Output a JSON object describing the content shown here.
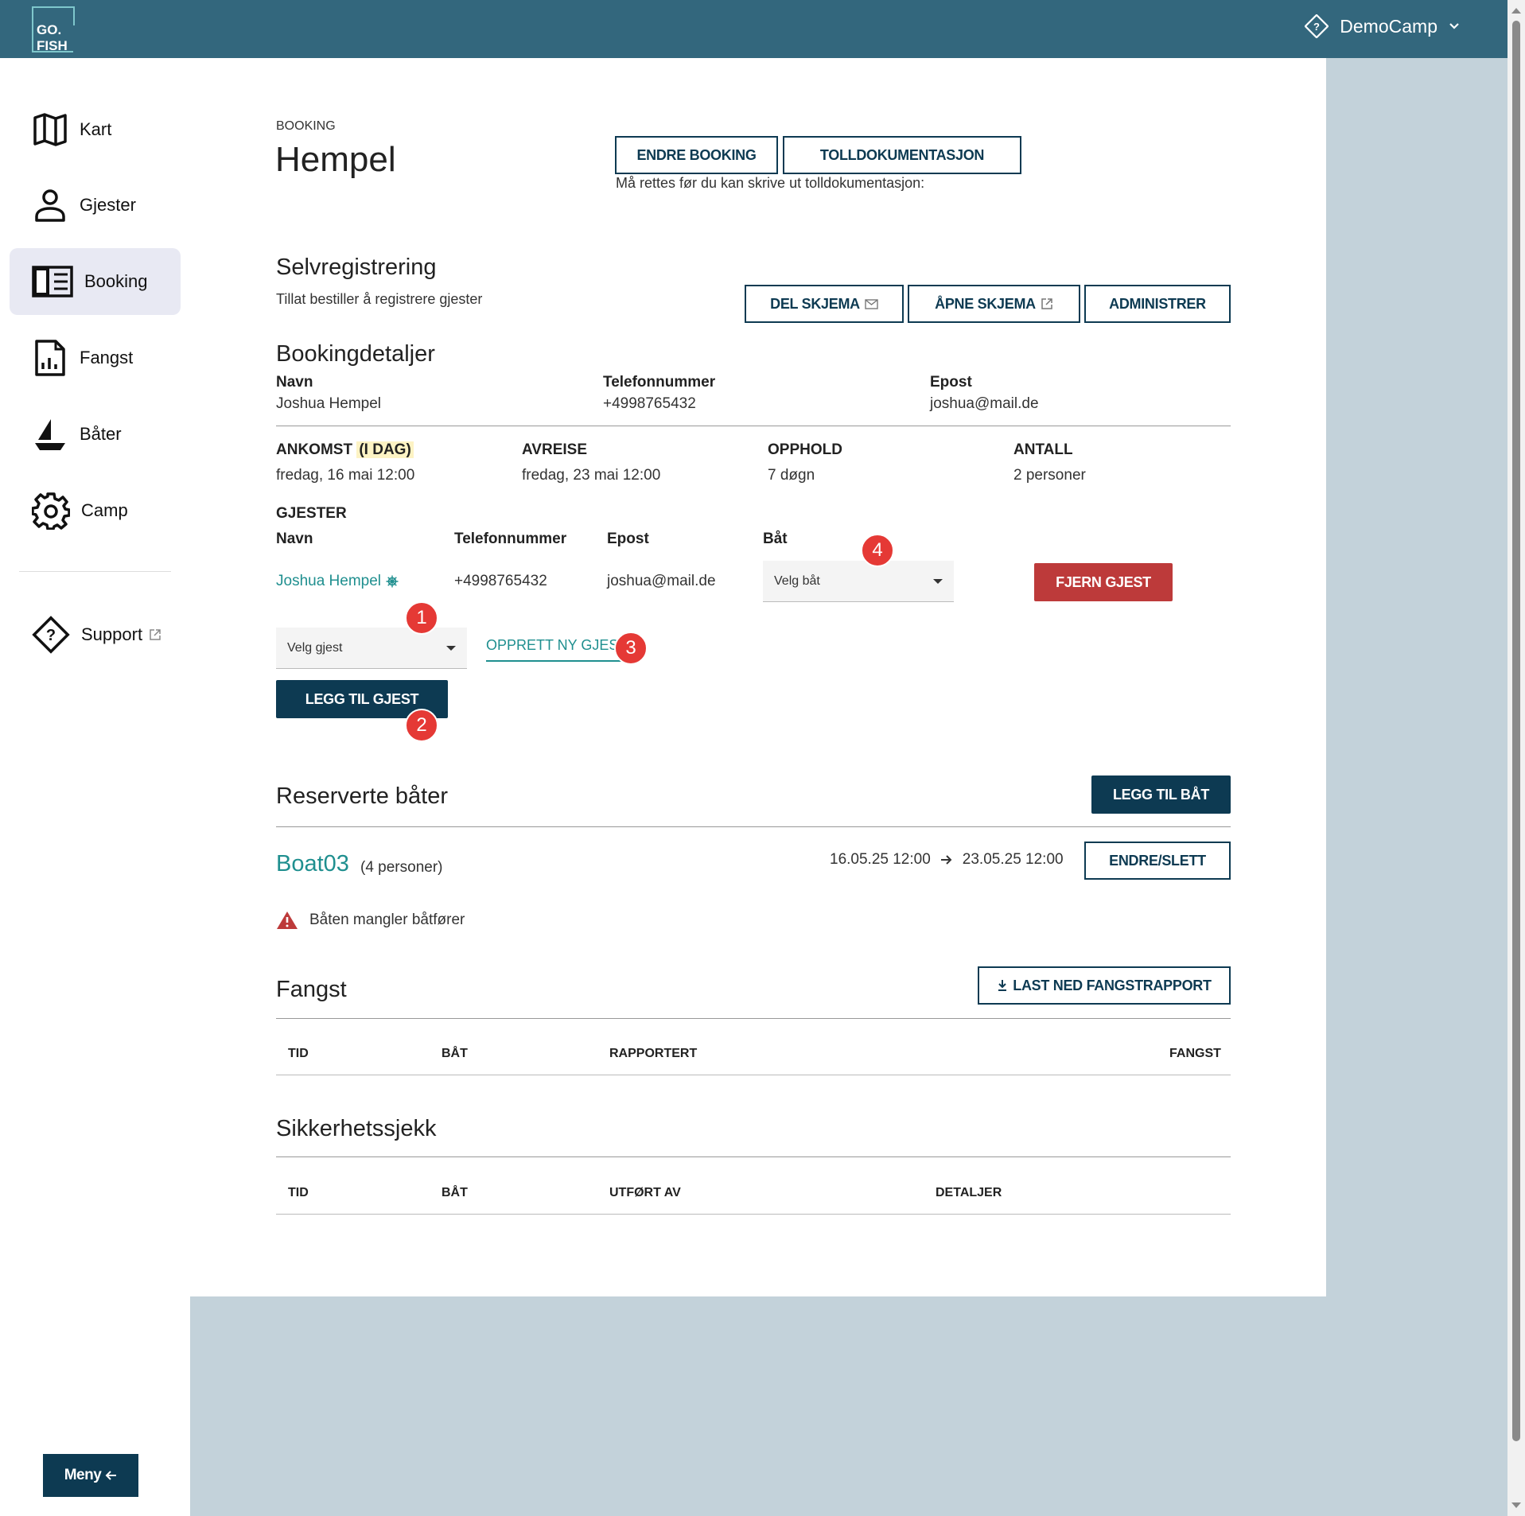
{
  "app": {
    "logo_line1": "GO.",
    "logo_line2": "FISH",
    "camp_name": "DemoCamp"
  },
  "sidebar": {
    "items": [
      {
        "label": "Kart",
        "icon": "map-icon"
      },
      {
        "label": "Gjester",
        "icon": "person-icon"
      },
      {
        "label": "Booking",
        "icon": "book-icon"
      },
      {
        "label": "Fangst",
        "icon": "report-icon"
      },
      {
        "label": "Båter",
        "icon": "sailboat-icon"
      },
      {
        "label": "Camp",
        "icon": "gear-icon"
      }
    ],
    "support_label": "Support",
    "menu_label": "Meny",
    "active": "Booking"
  },
  "header": {
    "kicker": "BOOKING",
    "title": "Hempel",
    "edit_booking": "ENDRE BOOKING",
    "customs_docs": "TOLLDOKUMENTASJON",
    "customs_note": "Må rettes før du kan skrive ut tolldokumentasjon:"
  },
  "self_registration": {
    "title": "Selvregistrering",
    "description": "Tillat bestiller å registrere gjester",
    "share_form": "DEL SKJEMA",
    "open_form": "ÅPNE SKJEMA",
    "manage": "ADMINISTRER"
  },
  "details": {
    "title": "Bookingdetaljer",
    "name_label": "Navn",
    "name_value": "Joshua Hempel",
    "phone_label": "Telefonnummer",
    "phone_value": "+4998765432",
    "email_label": "Epost",
    "email_value": "joshua@mail.de",
    "arrival_label": "ANKOMST",
    "arrival_tag": "(I DAG)",
    "arrival_value": "fredag, 16 mai 12:00",
    "departure_label": "AVREISE",
    "departure_value": "fredag, 23 mai 12:00",
    "stay_label": "OPPHOLD",
    "stay_value": "7 døgn",
    "count_label": "ANTALL",
    "count_value": "2 personer"
  },
  "guests": {
    "title": "GJESTER",
    "col_name": "Navn",
    "col_phone": "Telefonnummer",
    "col_email": "Epost",
    "col_boat": "Båt",
    "rows": [
      {
        "name": "Joshua Hempel",
        "phone": "+4998765432",
        "email": "joshua@mail.de",
        "boat_placeholder": "Velg båt",
        "remove": "FJERN GJEST"
      }
    ],
    "select_guest_placeholder": "Velg gjest",
    "create_new": "OPPRETT NY GJEST",
    "add_guest": "LEGG TIL GJEST",
    "badges": [
      "1",
      "2",
      "3",
      "4"
    ]
  },
  "boats": {
    "title": "Reserverte båter",
    "add_boat": "LEGG TIL BÅT",
    "items": [
      {
        "name": "Boat03",
        "capacity": "(4 personer)",
        "from": "16.05.25 12:00",
        "to": "23.05.25 12:00",
        "action": "ENDRE/SLETT",
        "warning": "Båten mangler båtfører"
      }
    ]
  },
  "catch": {
    "title": "Fangst",
    "download": "LAST NED FANGSTRAPPORT",
    "columns": [
      "TID",
      "BÅT",
      "RAPPORTERT",
      "FANGST"
    ]
  },
  "safety": {
    "title": "Sikkerhetssjekk",
    "columns": [
      "TID",
      "BÅT",
      "UTFØRT AV",
      "DETALJER"
    ]
  },
  "colors": {
    "topbar": "#33677d",
    "primary": "#0d3a52",
    "danger": "#bd3a3a",
    "teal": "#1f8f8f",
    "badge": "#e53935",
    "backdrop": "#c3d2da"
  }
}
